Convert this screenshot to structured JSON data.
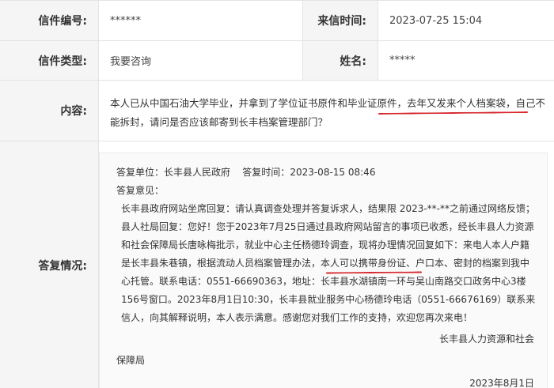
{
  "letter": {
    "number_label": "信件编号:",
    "number_value": "******",
    "time_label": "来信时间:",
    "time_value": "2023-07-25 15:04",
    "type_label": "信件类型:",
    "type_value": "我要咨询",
    "name_label": "姓名:",
    "name_value": "*****",
    "content_label": "内容:",
    "content_value": "本人已从中国石油大学毕业，并拿到了学位证书原件和毕业证原件，去年又发来个人档案袋，自己不能拆封，请问是否应该邮寄到长丰档案管理部门？",
    "reply_label": "答复情况:"
  },
  "reply": {
    "unit_label": "答复单位：",
    "unit_value": "长丰县人民政府",
    "time_label": "答复时间：",
    "time_value": "2023-08-15 08:46",
    "opinion_label": "答复意见：",
    "body": "长丰县政府网站坐席回复：请认真调查处理并答复诉求人，结果限 2023-**-**之前通过网络反馈；县人社局回复：您好！您于2023年7月25日通过县政府网站留言的事项已收悉，经长丰县人力资源和社会保障局长唐咏梅批示，就业中心主任杨德玲调查，现将办理情况回复如下：来电人本人户籍是长丰县朱巷镇，根据流动人员档案管理办法，本人可以携带身份证、户口本、密封的档案到我中心托管。联系电话：0551-66690363，地址：长丰县水湖镇南一环与吴山南路交口政务中心3楼156号窗口。2023年8月1日10:30，长丰县就业服务中心杨德玲电话（0551-66676169）联系来信人，向其解释说明，本人表示满意。感谢您对我们工作的支持，欢迎您再次来电！",
    "signature_line1": "长丰县人力资源和社会",
    "signature_line2": "保障局",
    "date": "2023年8月1日"
  },
  "colors": {
    "label_bg": "#f5f5f5",
    "border": "#e3e3e3",
    "underline": "#d6262b"
  }
}
